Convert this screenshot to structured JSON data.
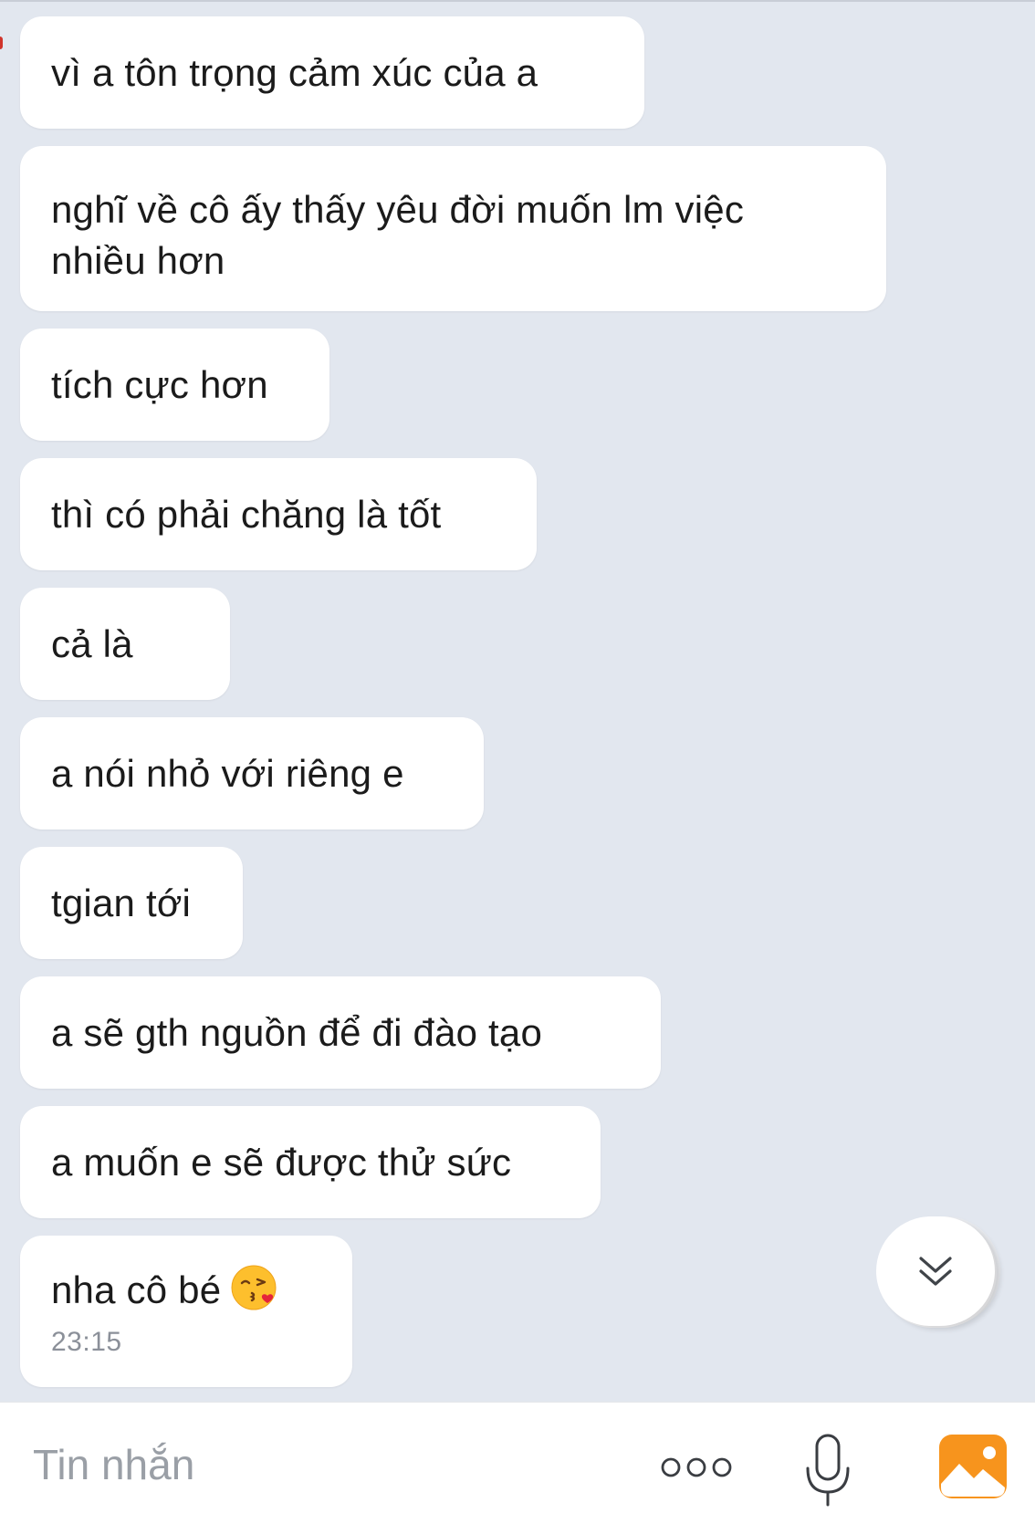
{
  "messages": [
    {
      "text": "vì a tôn trọng cảm xúc của a"
    },
    {
      "text": "nghĩ về cô ấy thấy yêu đời muốn lm việc\nnhiều hơn"
    },
    {
      "text": "tích cực hơn"
    },
    {
      "text": "thì có phải chăng là tốt"
    },
    {
      "text": "cả là"
    },
    {
      "text": "a nói nhỏ với riêng e"
    },
    {
      "text": "tgian tới"
    },
    {
      "text": "a sẽ gth nguồn để đi đào tạo"
    },
    {
      "text": "a muốn e sẽ được thử sức"
    },
    {
      "text": "nha cô bé",
      "emoji": "face-blowing-a-kiss",
      "time": "23:15"
    }
  ],
  "scroll_button": {
    "icon": "double-chevron-down-icon"
  },
  "composer": {
    "placeholder": "Tin nhắn",
    "more_icon": "more-dots-icon",
    "mic_icon": "microphone-icon",
    "photo_icon": "photo-icon",
    "photo_color": "#f7941d"
  },
  "colors": {
    "chat_background": "#e2e7ef",
    "bubble": "#ffffff",
    "text": "#1b1b1b",
    "time": "#8b9099"
  }
}
